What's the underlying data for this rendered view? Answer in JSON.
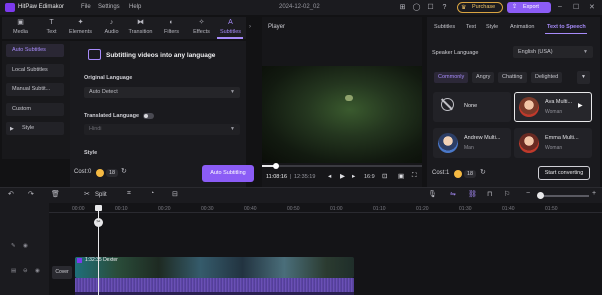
{
  "app": {
    "title": "HitPaw Edimakor",
    "menus": [
      "File",
      "Settings",
      "Help"
    ],
    "project_title": "2024-12-02_02",
    "purchase_label": "Purchase",
    "export_label": "Export"
  },
  "toolbar": {
    "items": [
      {
        "label": "Media",
        "icon": "media-icon"
      },
      {
        "label": "Text",
        "icon": "text-icon"
      },
      {
        "label": "Elements",
        "icon": "elements-icon"
      },
      {
        "label": "Audio",
        "icon": "audio-icon"
      },
      {
        "label": "Transition",
        "icon": "transition-icon"
      },
      {
        "label": "Filters",
        "icon": "filters-icon"
      },
      {
        "label": "Effects",
        "icon": "effects-icon"
      },
      {
        "label": "Subtitles",
        "icon": "subtitles-icon",
        "active": true
      }
    ]
  },
  "subnav": {
    "items": [
      "Auto Subtitles",
      "Local Subtitles",
      "Manual Subtit...",
      "Custom",
      "Style"
    ],
    "active": "Auto Subtitles"
  },
  "subtitle_panel": {
    "heading": "Subtitling videos into any language",
    "original_language_label": "Original Language",
    "original_language_value": "Auto Detect",
    "translated_language_label": "Translated Language",
    "translated_language_value": "Hindi",
    "style_label": "Style",
    "cost_label": "Cost:0",
    "cost_value": "18",
    "action_label": "Auto Subtitling"
  },
  "player": {
    "label": "Player",
    "time_current": "11:08:16",
    "time_total": "12:35:19",
    "ratio": "16:9"
  },
  "right_panel": {
    "tabs": [
      "Subtitles",
      "Text",
      "Style",
      "Animation",
      "Text to Speech"
    ],
    "active_tab": "Text to Speech",
    "speaker_language_label": "Speaker Language",
    "speaker_language_value": "English (USA)",
    "chips": [
      "Commonly",
      "Angry",
      "Chatting",
      "Delighted"
    ],
    "active_chip": "Commonly",
    "voices": [
      {
        "name": "None",
        "gender": ""
      },
      {
        "name": "Ava Multi...",
        "gender": "Woman",
        "selected": true
      },
      {
        "name": "Andrew Multi...",
        "gender": "Man"
      },
      {
        "name": "Emma Multi...",
        "gender": "Woman"
      }
    ],
    "cost_label": "Cost:1",
    "cost_value": "18",
    "convert_label": "Start converting"
  },
  "timeline_toolbar": {
    "split_label": "Split"
  },
  "timeline": {
    "ruler": [
      "00:00",
      "00:10",
      "00:20",
      "00:30",
      "00:40",
      "00:50",
      "01:00",
      "01:10",
      "01:20",
      "01:30",
      "01:40",
      "01:50"
    ],
    "cover_label": "Cover",
    "clip_label": "1:32:35 Dexter"
  },
  "colors": {
    "accent": "#8b5cf6",
    "accent_text": "#a78bfa",
    "gold": "#f5b942",
    "background": "#121214"
  }
}
